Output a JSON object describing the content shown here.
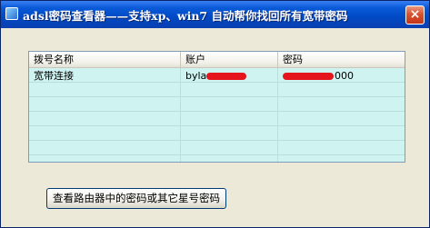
{
  "window": {
    "title": "adsl密码查看器——支持xp、win7 自动帮你找回所有宽带密码",
    "close_label": "×"
  },
  "table": {
    "columns": [
      "拨号名称",
      "账户",
      "密码"
    ],
    "rows": [
      {
        "name": "宽带连接",
        "account_visible": "byla",
        "password_visible": "000"
      }
    ]
  },
  "actions": {
    "view_router_label": "查看路由器中的密码或其它星号密码"
  },
  "colors": {
    "titlebar": "#0049c4",
    "window_bg": "#ece9d8",
    "list_bg": "#cff3f1",
    "redaction": "#e4151d"
  }
}
